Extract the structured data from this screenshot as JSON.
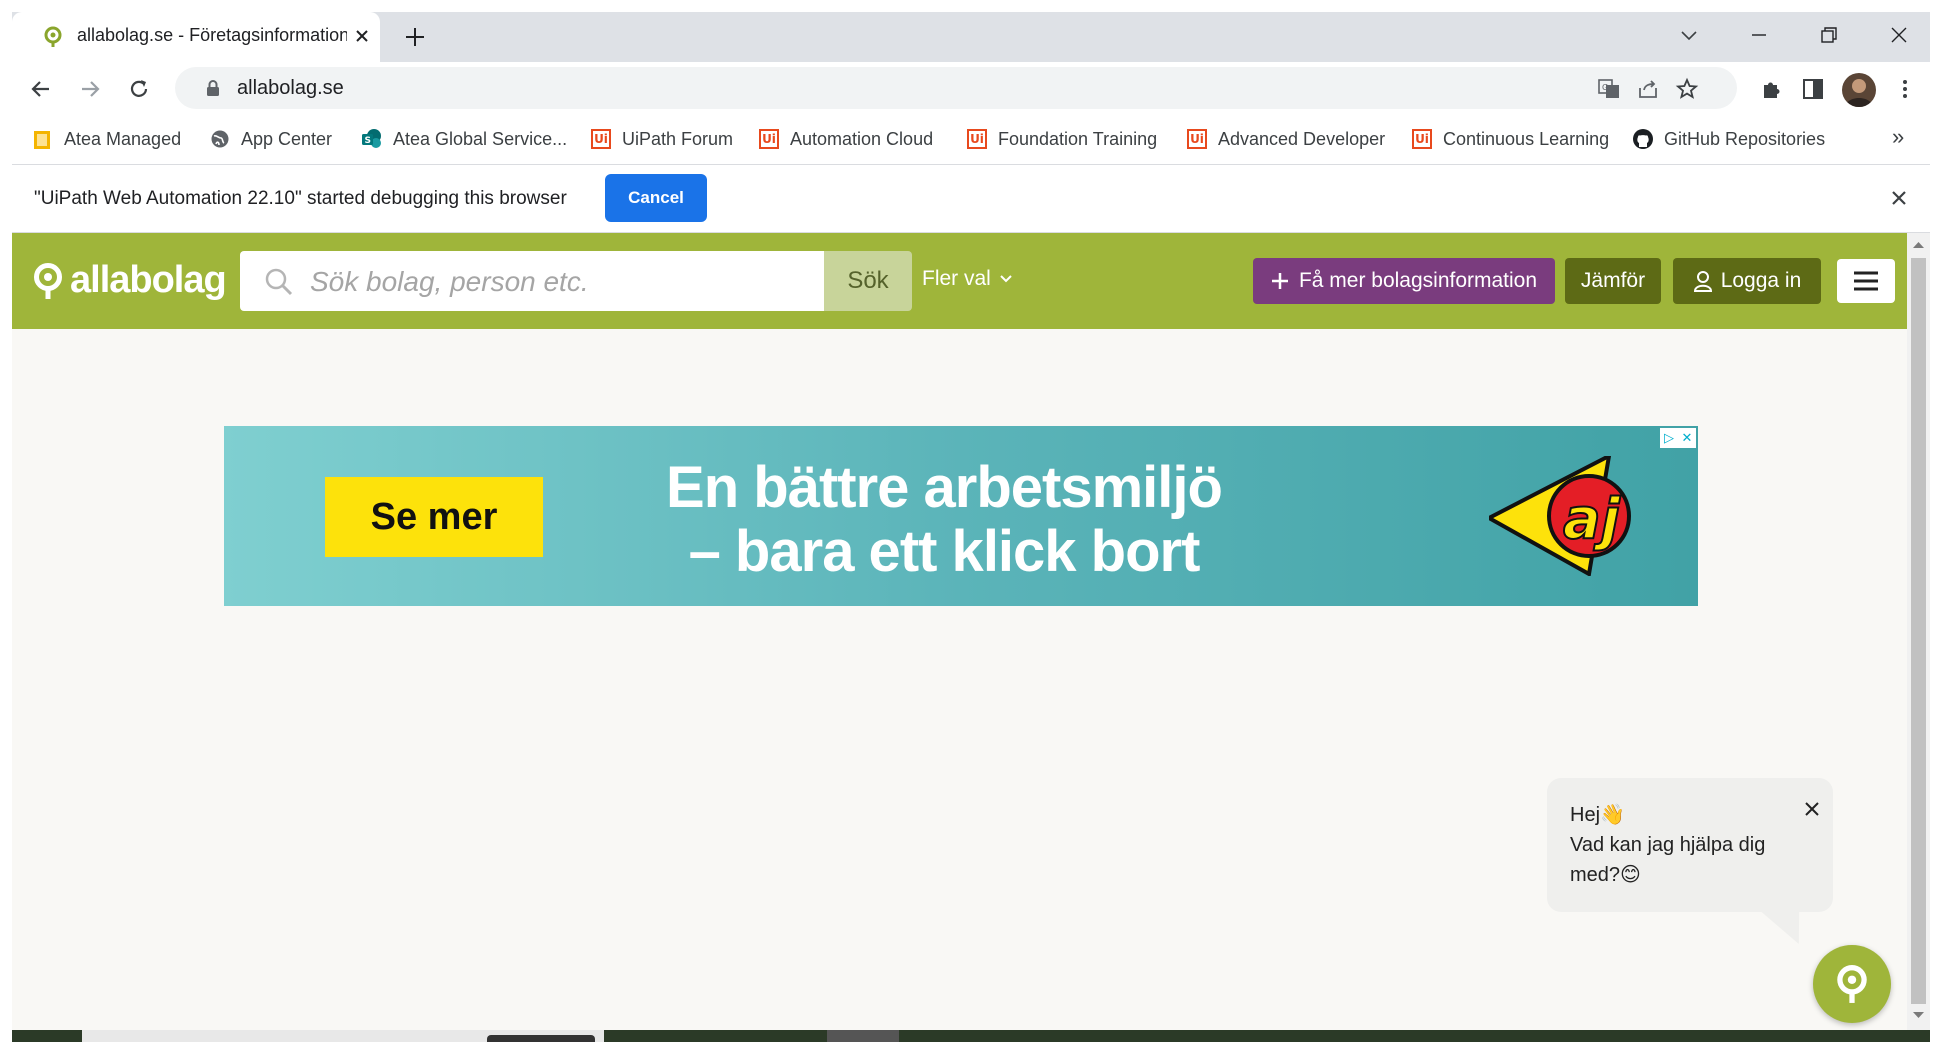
{
  "browser": {
    "tab": {
      "title": "allabolag.se - Företagsinformation"
    },
    "address": {
      "url": "allabolag.se"
    },
    "bookmarks": [
      {
        "label": "Atea Managed",
        "icon": "folder-icon"
      },
      {
        "label": "App Center",
        "icon": "globe-icon"
      },
      {
        "label": "Atea Global Service...",
        "icon": "sharepoint-icon"
      },
      {
        "label": "UiPath Forum",
        "icon": "uipath-icon"
      },
      {
        "label": "Automation Cloud",
        "icon": "uipath-icon"
      },
      {
        "label": "Foundation Training",
        "icon": "uipath-icon"
      },
      {
        "label": "Advanced Developer",
        "icon": "uipath-icon"
      },
      {
        "label": "Continuous Learning",
        "icon": "uipath-icon"
      },
      {
        "label": "GitHub Repositories",
        "icon": "github-icon"
      }
    ],
    "bookmarks_more": "»",
    "infobar": {
      "message": "\"UiPath Web Automation 22.10\" started debugging this browser",
      "cancel_label": "Cancel"
    }
  },
  "site": {
    "logo": "allabolag",
    "search": {
      "placeholder": "Sök bolag, person etc.",
      "value": "",
      "button": "Sök"
    },
    "more_options": "Fler val",
    "header_buttons": {
      "more_info": "Få mer bolagsinformation",
      "compare": "Jämför",
      "login": "Logga in"
    },
    "ad": {
      "cta": "Se mer",
      "headline_line1": "En bättre arbetsmiljö",
      "headline_line2": "– bara ett klick bort",
      "brand": "AJ"
    },
    "chat": {
      "greeting": "Hej👋",
      "question": "Vad kan jag hjälpa dig med?😊"
    }
  },
  "colors": {
    "brand_green": "#9fb53a",
    "purple": "#7a3c7e",
    "dark_green": "#5d6a15",
    "chrome_blue": "#1a73e8",
    "ad_yellow": "#fde20b"
  }
}
